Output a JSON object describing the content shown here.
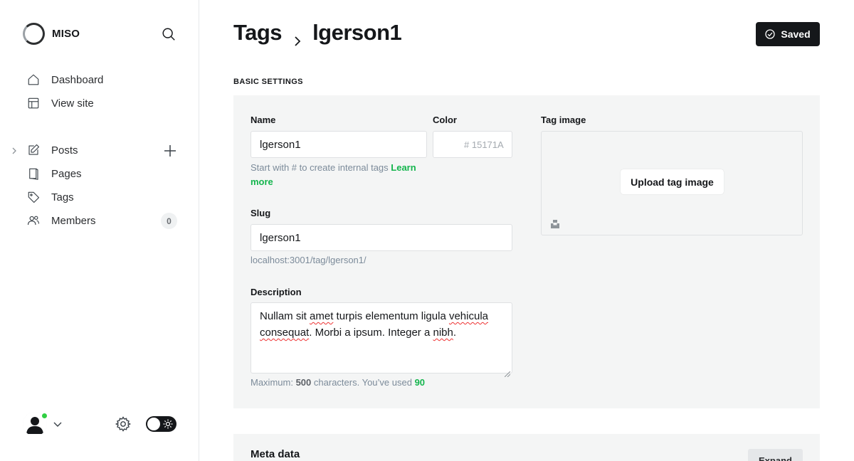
{
  "app": {
    "brand_name": "MISO"
  },
  "sidebar": {
    "primary": [
      {
        "label": "Dashboard",
        "icon": "house-icon"
      },
      {
        "label": "View site",
        "icon": "layout-icon"
      }
    ],
    "content": [
      {
        "label": "Posts",
        "icon": "pencil-square-icon"
      },
      {
        "label": "Pages",
        "icon": "page-icon"
      },
      {
        "label": "Tags",
        "icon": "tag-icon"
      },
      {
        "label": "Members",
        "icon": "members-icon",
        "count": "0"
      }
    ]
  },
  "header": {
    "breadcrumb_parent": "Tags",
    "breadcrumb_current": "lgerson1",
    "saved_label": "Saved"
  },
  "basic_settings": {
    "heading": "BASIC SETTINGS",
    "name": {
      "label": "Name",
      "value": "lgerson1",
      "hint": "Start with # to create internal tags",
      "hint_link": "Learn more"
    },
    "color": {
      "label": "Color",
      "prefix": "#",
      "placeholder": "15171A"
    },
    "tag_image": {
      "label": "Tag image",
      "upload_label": "Upload tag image"
    },
    "slug": {
      "label": "Slug",
      "value": "lgerson1",
      "url_preview": "localhost:3001/tag/lgerson1/"
    },
    "description": {
      "label": "Description",
      "text_part1": "Nullam sit ",
      "text_sp1": "amet",
      "text_part2": " turpis elementum ligula ",
      "text_sp2": "vehicula",
      "text_sp3": "consequat",
      "text_part3": ". Morbi a ipsum. Integer a ",
      "text_sp4": "nibh",
      "text_part4": ".",
      "hint_prefix": "Maximum:",
      "max_chars": "500",
      "hint_middle": "characters. You’ve used",
      "used_chars": "90"
    }
  },
  "meta_data": {
    "title": "Meta data",
    "expand_label": "Expand"
  },
  "colors": {
    "accent_green": "#30cf43",
    "dark": "#15171a",
    "panel_bg": "#f4f5f5"
  }
}
